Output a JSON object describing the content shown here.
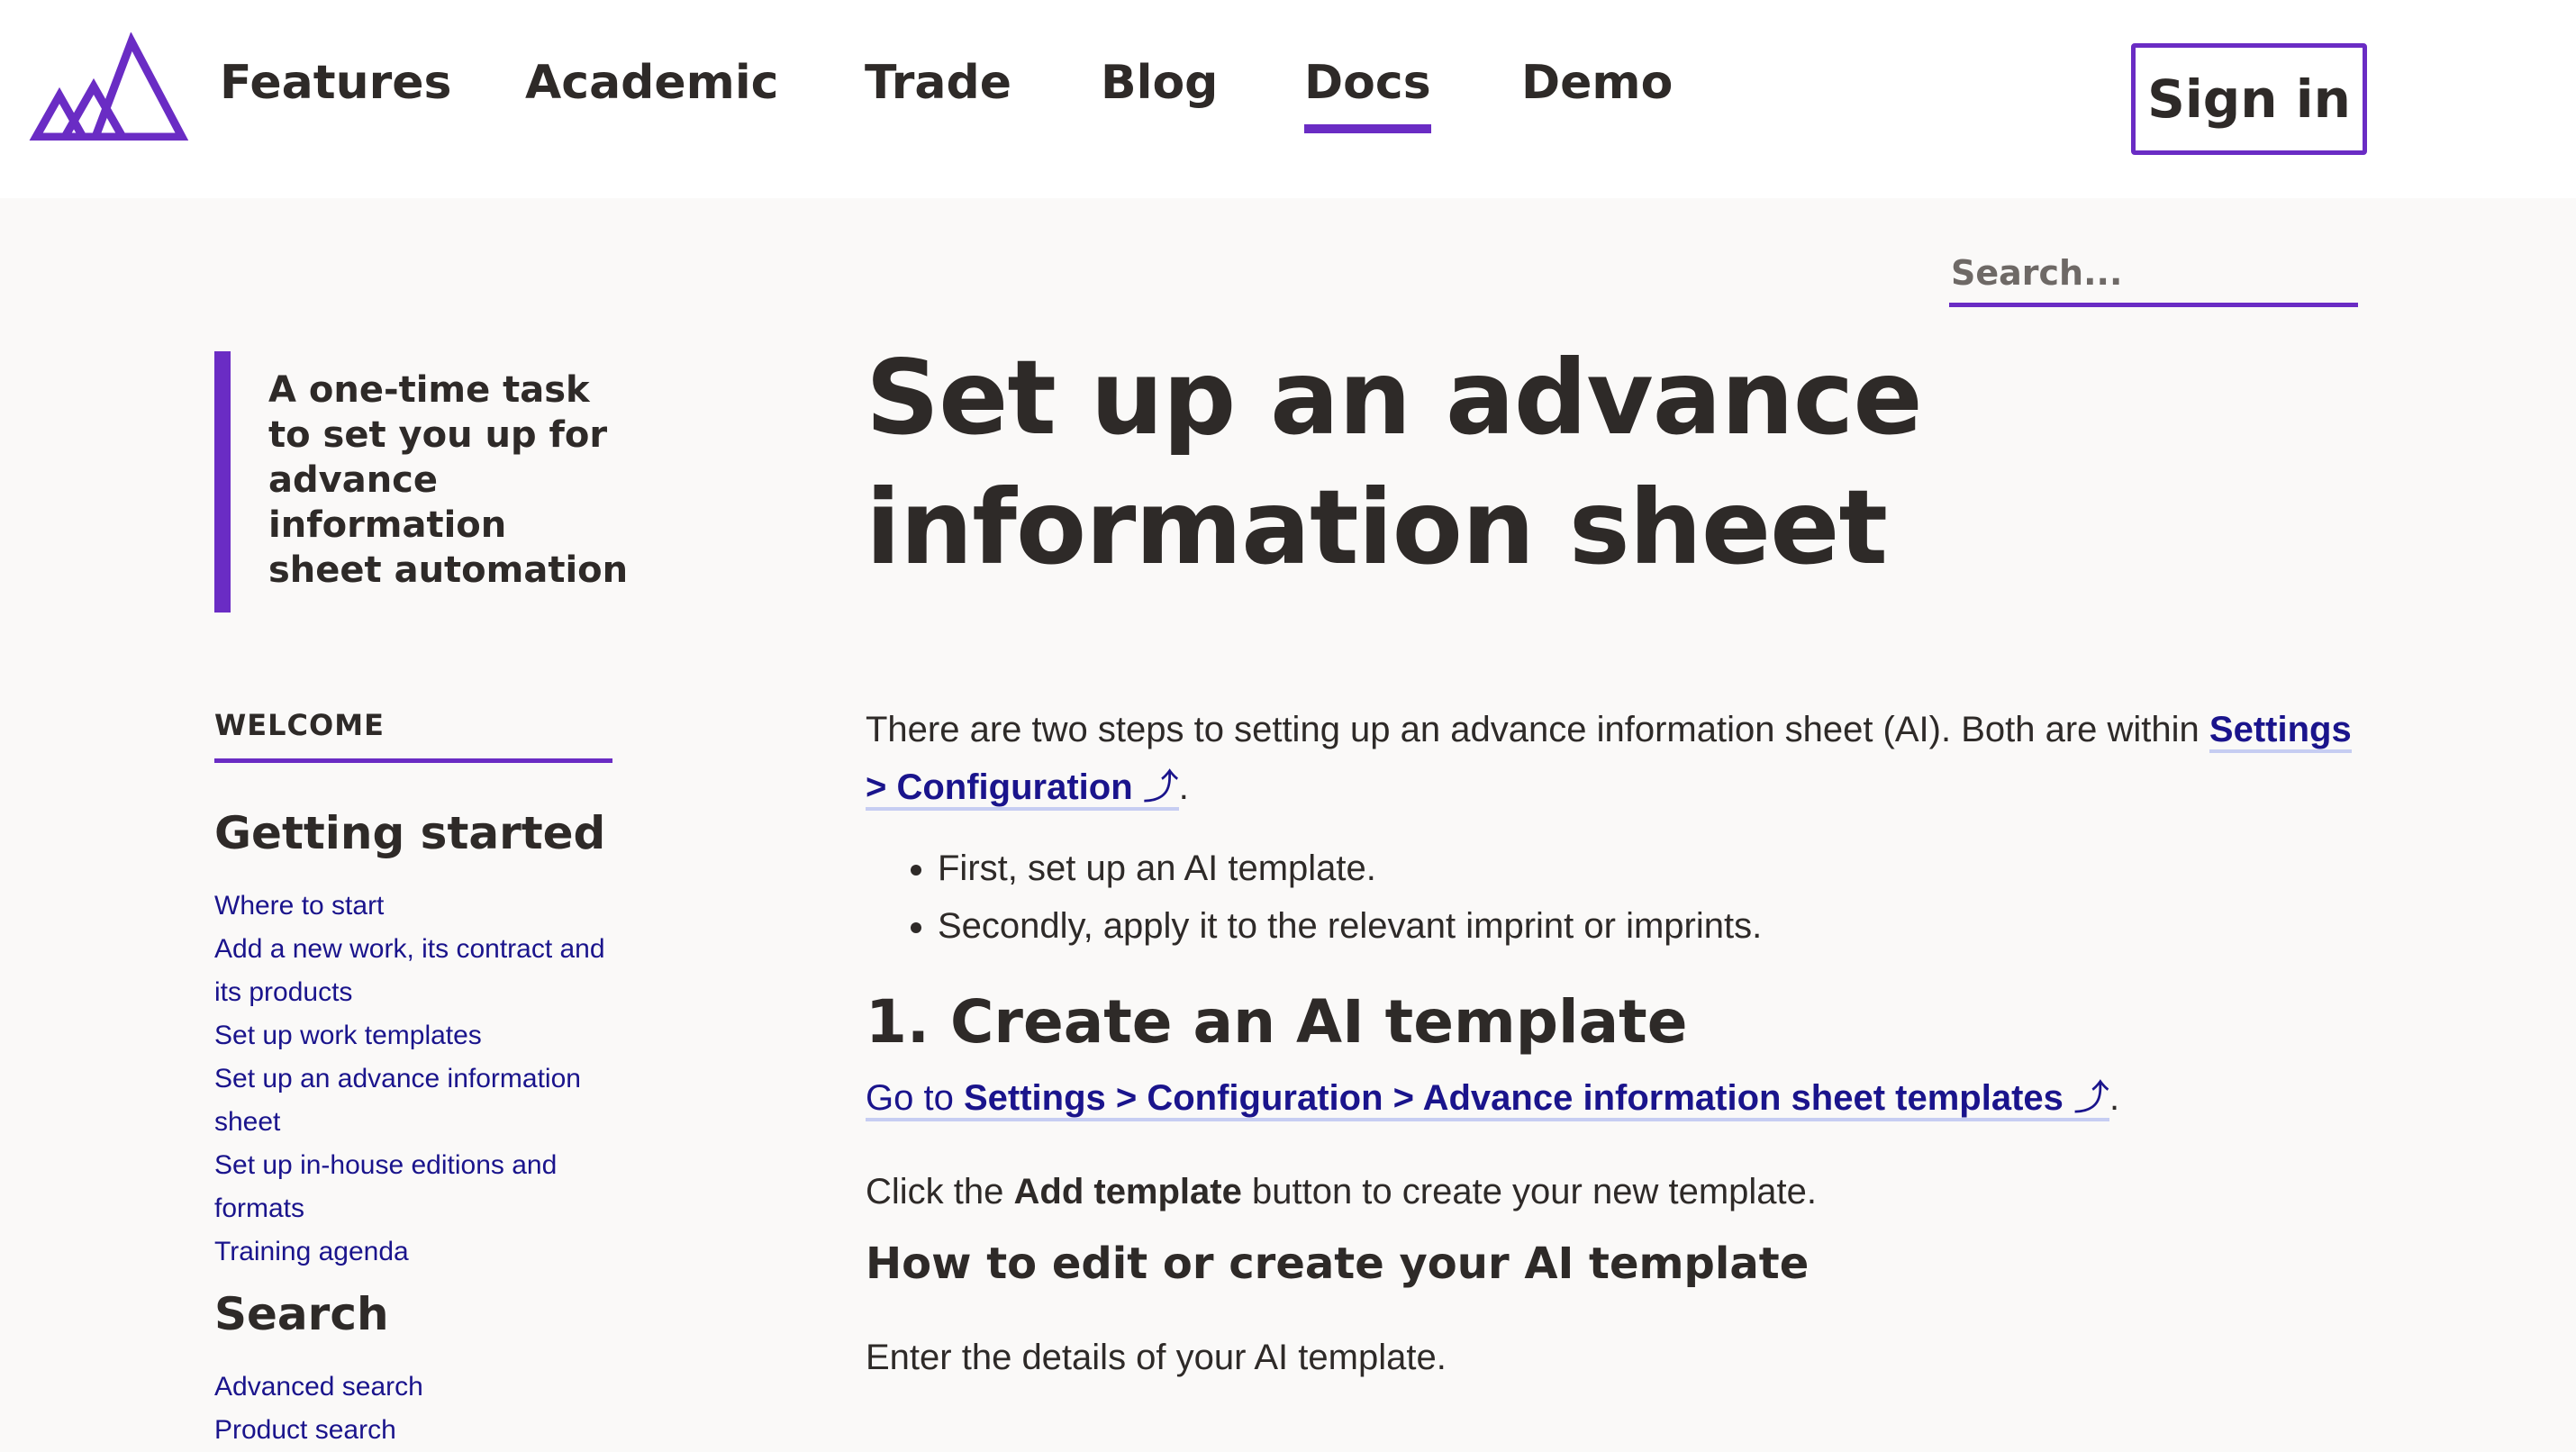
{
  "nav": {
    "items": [
      {
        "label": "Features"
      },
      {
        "label": "Academic"
      },
      {
        "label": "Trade"
      },
      {
        "label": "Blog"
      },
      {
        "label": "Docs",
        "active": true
      },
      {
        "label": "Demo"
      }
    ],
    "sign_in": "Sign in"
  },
  "search": {
    "placeholder": "Search..."
  },
  "sidebar": {
    "tagline": "A one-time task to set you up for advance information sheet automation",
    "section_label": "WELCOME",
    "groups": [
      {
        "heading": "Getting started",
        "links": [
          "Where to start",
          "Add a new work, its contract and its products",
          "Set up work templates",
          "Set up an advance information sheet",
          "Set up in-house editions and formats",
          "Training agenda"
        ]
      },
      {
        "heading": "Search",
        "links": [
          "Advanced search",
          "Product search"
        ]
      }
    ]
  },
  "main": {
    "title": "Set up an advance information sheet",
    "intro_text": "There are two steps to setting up an advance information sheet (AI). Both are within ",
    "intro_link": "Settings > Configuration",
    "external_icon": "⤴",
    "bullets": [
      "First, set up an AI template.",
      "Secondly, apply it to the relevant imprint or imprints."
    ],
    "step1_heading": "1. Create an AI template",
    "goto_prefix": "Go to ",
    "goto_link": "Settings > Configuration > Advance information sheet templates",
    "click_prefix": "Click the ",
    "click_bold": "Add template",
    "click_suffix": " button to create your new template.",
    "subheading": "How to edit or create your AI template",
    "enter_text": "Enter the details of your AI template."
  },
  "colors": {
    "accent": "#6a2cc4",
    "link": "#1a148c",
    "text": "#2e2a28",
    "background": "#faf9f8"
  }
}
